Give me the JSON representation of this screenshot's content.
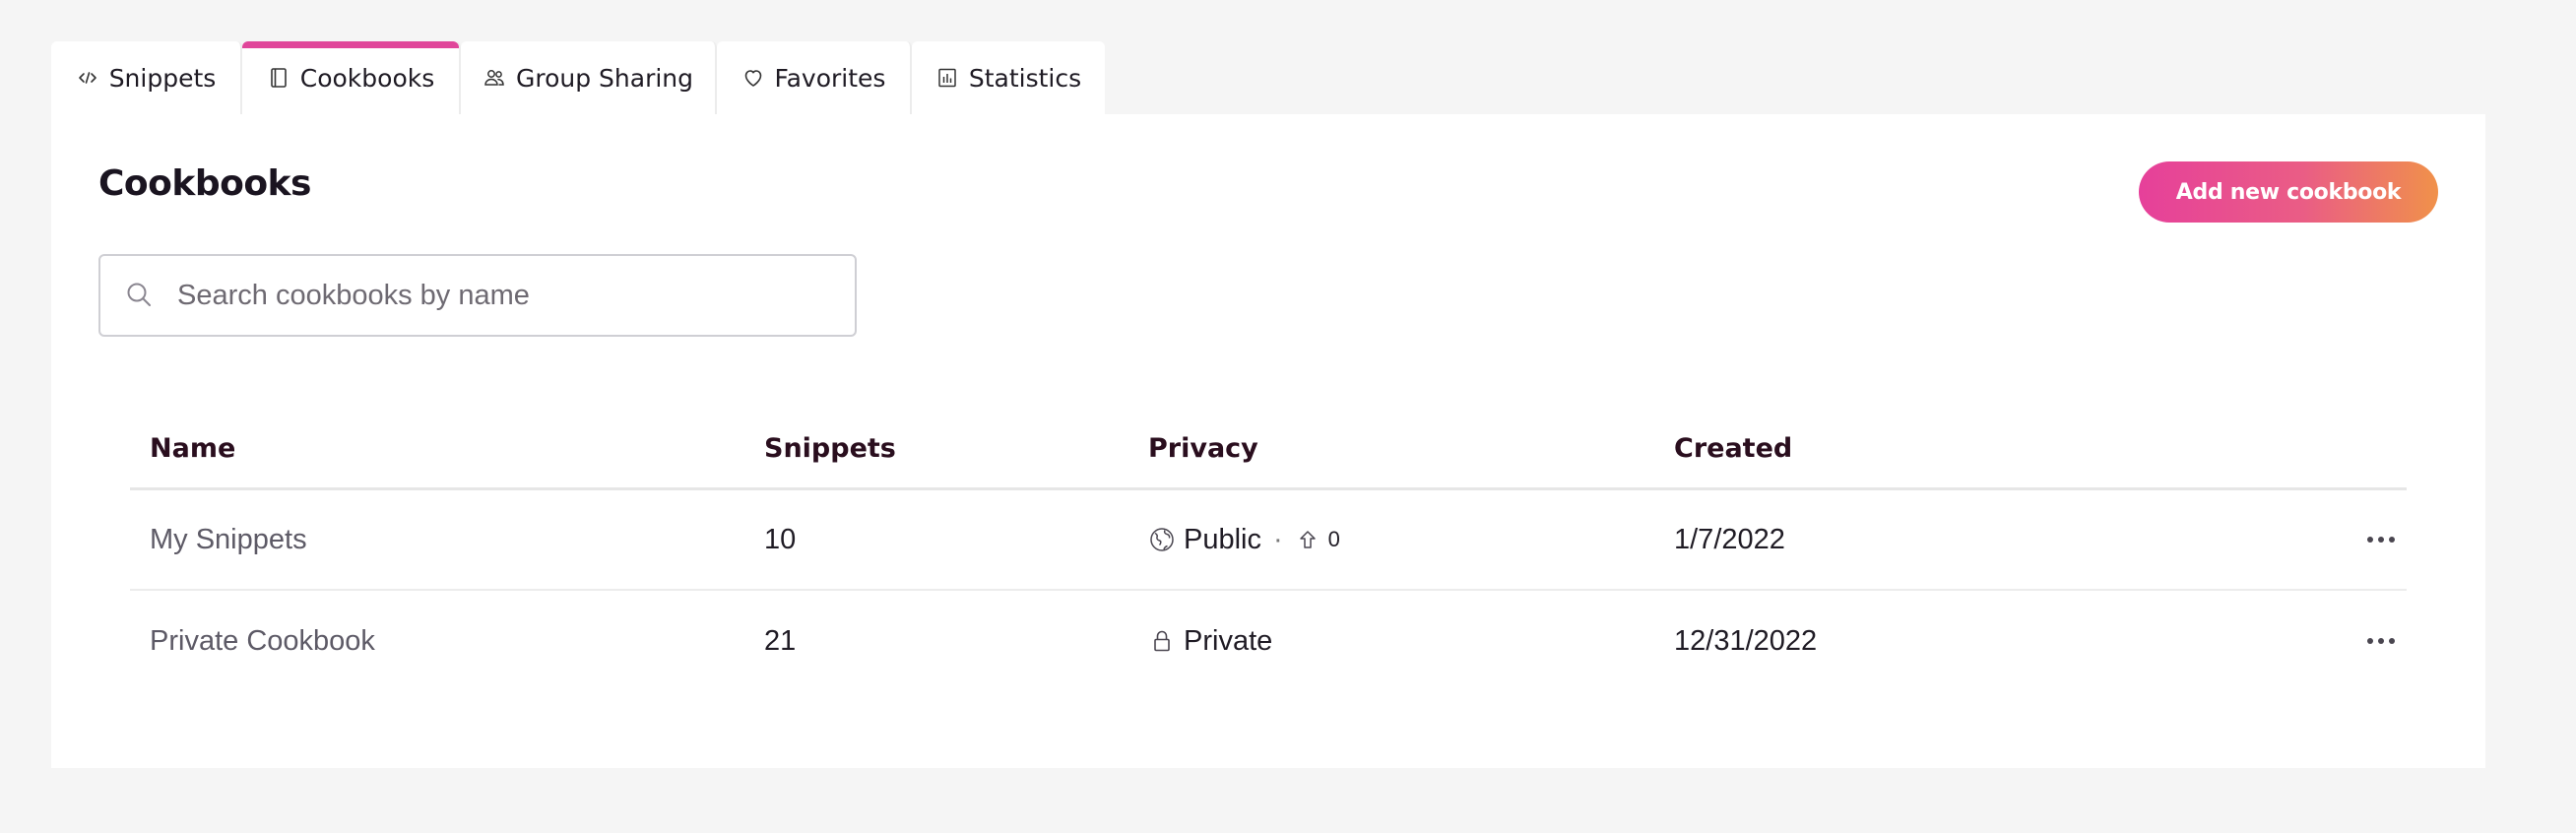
{
  "tabs": [
    {
      "label": "Snippets",
      "icon": "code-icon",
      "active": false
    },
    {
      "label": "Cookbooks",
      "icon": "book-icon",
      "active": true
    },
    {
      "label": "Group Sharing",
      "icon": "users-icon",
      "active": false
    },
    {
      "label": "Favorites",
      "icon": "heart-icon",
      "active": false
    },
    {
      "label": "Statistics",
      "icon": "bar-chart-icon",
      "active": false
    }
  ],
  "page": {
    "title": "Cookbooks",
    "add_button_label": "Add new cookbook"
  },
  "search": {
    "placeholder": "Search cookbooks by name",
    "value": ""
  },
  "table": {
    "columns": [
      "Name",
      "Snippets",
      "Privacy",
      "Created"
    ],
    "rows": [
      {
        "name": "My Snippets",
        "snippets": "10",
        "privacy": "Public",
        "privacy_icon": "globe-icon",
        "upvotes": "0",
        "created": "1/7/2022"
      },
      {
        "name": "Private Cookbook",
        "snippets": "21",
        "privacy": "Private",
        "privacy_icon": "lock-icon",
        "created": "12/31/2022"
      }
    ]
  },
  "colors": {
    "accent": "#e0469a",
    "button_gradient_start": "#e6409a",
    "button_gradient_end": "#f0914a",
    "background": "#f5f5f5",
    "panel": "#ffffff"
  }
}
